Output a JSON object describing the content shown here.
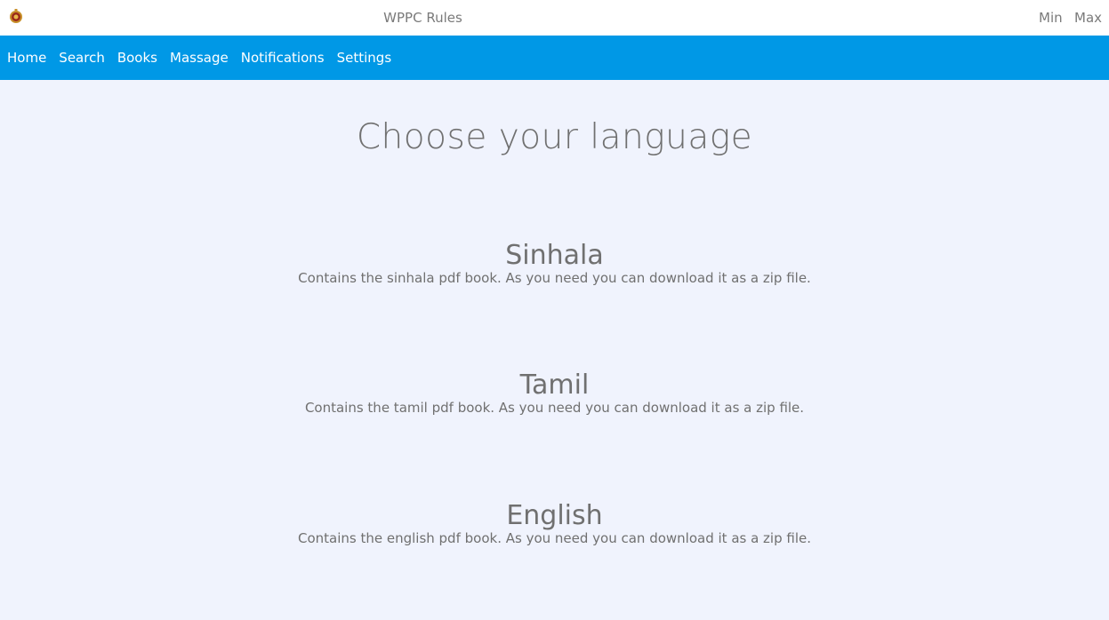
{
  "titlebar": {
    "title": "WPPC Rules",
    "min_label": "Min",
    "max_label": "Max",
    "logo_icon": "emblem-icon"
  },
  "nav": {
    "items": [
      {
        "label": "Home"
      },
      {
        "label": "Search"
      },
      {
        "label": "Books"
      },
      {
        "label": "Massage"
      },
      {
        "label": "Notifications"
      },
      {
        "label": "Settings"
      }
    ]
  },
  "main": {
    "title": "Choose your language",
    "languages": [
      {
        "name": "Sinhala",
        "description": "Contains the sinhala pdf book. As you need you can download it as a zip file."
      },
      {
        "name": "Tamil",
        "description": "Contains the tamil pdf book. As you need you can download it as a zip file."
      },
      {
        "name": "English",
        "description": "Contains the english pdf book. As you need you can download it as a zip file."
      }
    ]
  },
  "colors": {
    "nav_background": "#0098e6",
    "page_background": "#f0f3fd",
    "text": "#707070"
  }
}
